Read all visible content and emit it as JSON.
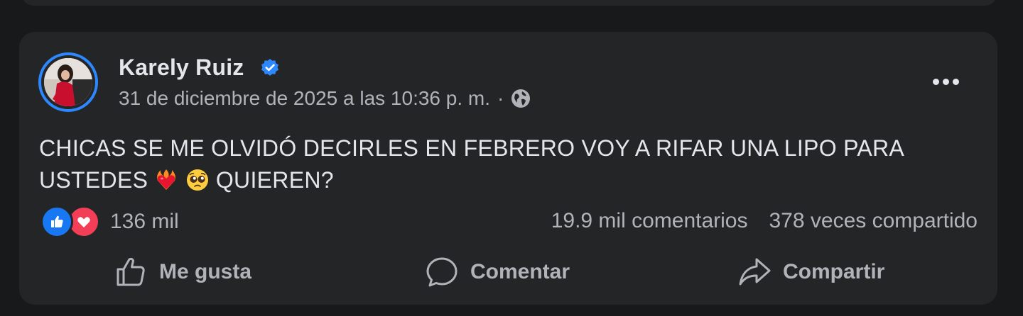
{
  "post": {
    "author": "Karely Ruiz",
    "timestamp": "31 de diciembre de 2025 a las 10:36 p. m.",
    "separator": "·",
    "text_line1": "CHICAS SE ME OLVIDÓ DECIRLES EN FEBRERO VOY A RIFAR UNA LIPO PARA",
    "text_line2_start": "USTEDES",
    "text_line2_end": "QUIEREN?",
    "emojis": [
      "heart-on-fire-emoji",
      "pleading-face-emoji"
    ]
  },
  "stats": {
    "reactions": "136 mil",
    "comments": "19.9 mil comentarios",
    "shares": "378 veces compartido"
  },
  "actions": {
    "like": "Me gusta",
    "comment": "Comentar",
    "share": "Compartir"
  },
  "icons": {
    "verified": "verified-badge-icon",
    "audience": "globe-icon",
    "more": "more-options-icon",
    "like": "thumbs-up-icon",
    "comment": "comment-bubble-icon",
    "share": "share-arrow-icon"
  },
  "colors": {
    "background": "#18191a",
    "card": "#242526",
    "primary_text": "#e4e6eb",
    "secondary_text": "#b0b3b8",
    "accent_blue": "#2d88ff",
    "like_blue": "#1877f2",
    "love_red": "#f33e58"
  }
}
